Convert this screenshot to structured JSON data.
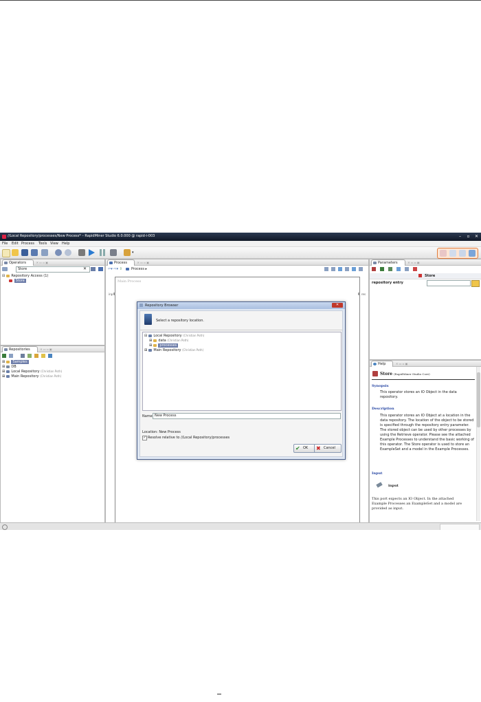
{
  "window": {
    "title": "//Local Repository/processes/New Process* – RapidMiner Studio 6.0.000 @ rapid-i-003"
  },
  "menu": [
    "File",
    "Edit",
    "Process",
    "Tools",
    "View",
    "Help"
  ],
  "operators": {
    "tab": "Operators",
    "search_value": "Store",
    "tree_root": "Repository Access (1)",
    "tree_child": "Store"
  },
  "repositories": {
    "tab": "Repositories",
    "items": [
      {
        "label": "Samples",
        "owner": ""
      },
      {
        "label": "DB",
        "owner": ""
      },
      {
        "label": "Local Repository",
        "owner": "(Christian Poth)"
      },
      {
        "label": "Main Repository",
        "owner": "(Christian Poth)"
      }
    ]
  },
  "process": {
    "tab": "Process",
    "breadcrumb": "Process",
    "canvas_label": "Main Process",
    "port_inp": "inp",
    "port_res": "res"
  },
  "dialog": {
    "title": "Repository Browser",
    "prompt": "Select a repository location.",
    "tree": [
      {
        "label": "Local Repository",
        "owner": "(Christian Poth)"
      },
      {
        "label": "data",
        "owner": "(Christian Poth)"
      },
      {
        "label": "processes",
        "owner": ""
      },
      {
        "label": "Main Repository",
        "owner": "(Christian Poth)"
      }
    ],
    "name_label": "Name",
    "name_value": "New Process",
    "location_text": "Location: New Process",
    "checkbox_label": "Resolve relative to //Local Repository/processes",
    "ok": "OK",
    "cancel": "Cancel"
  },
  "parameters": {
    "tab": "Parameters",
    "operator": "Store",
    "param_name": "repository entry",
    "param_value": ""
  },
  "help": {
    "tab": "Help",
    "title": "Store",
    "subtitle": "(RapidMiner Studio Core)",
    "synopsis_h": "Synopsis",
    "synopsis": "This operator stores an IO Object in the data repository.",
    "description_h": "Description",
    "description": "This operator stores an IO Object at a location in the data repository. The location of the object to be stored is specified through the repository entry parameter. The stored object can be used by other processes by using the Retrieve operator. Please see the attached Example Processes to understand the basic working of this operator. The Store operator is used to store an ExampleSet and a model in the Example Processes.",
    "input_h": "Input",
    "input_port": "input",
    "input_text": "This port expects an IO Object. In the attached Example Processes an ExampleSet and a model are provided as input."
  },
  "colors": {
    "accent": "#6b7ba8",
    "title_bar": "#1a2436",
    "help_heading": "#2040a0"
  }
}
